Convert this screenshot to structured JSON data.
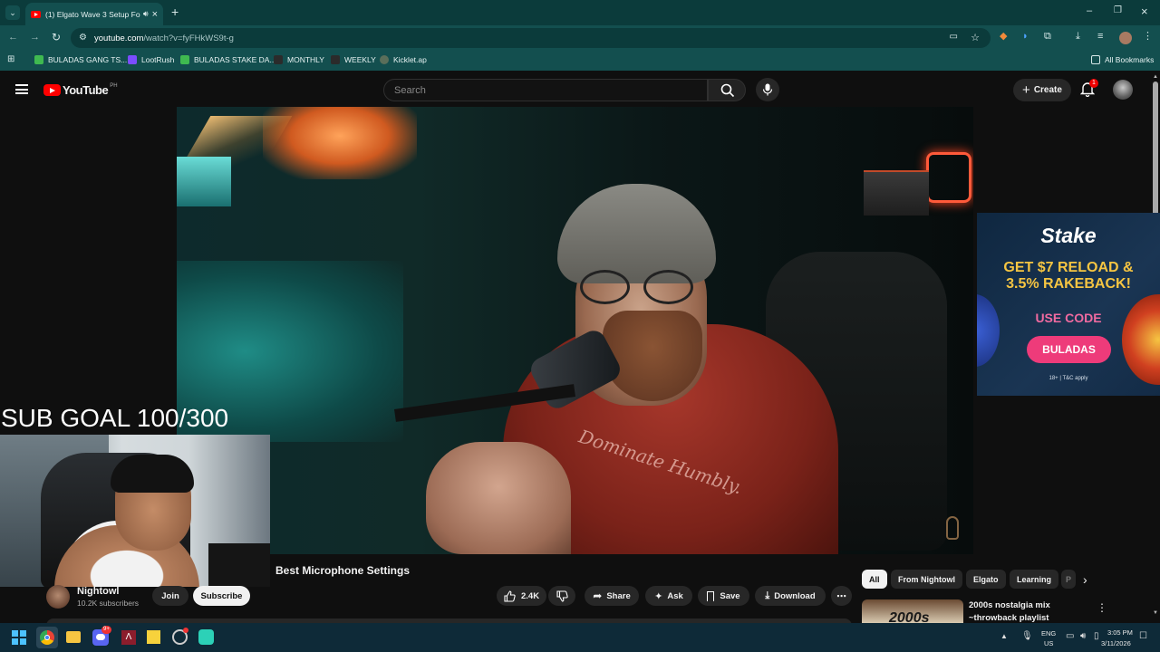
{
  "browser": {
    "tab_title": "(1) Elgato Wave 3 Setup Fo",
    "url_host": "youtube.com",
    "url_path": "/watch?v=fyFHkWS9t-g",
    "bookmarks": [
      {
        "label": "BULADAS GANG TS...",
        "color": "#3fb950"
      },
      {
        "label": "LootRush",
        "color": "#7b4dff"
      },
      {
        "label": "BULADAS STAKE DA...",
        "color": "#3fb950"
      },
      {
        "label": "MONTHLY",
        "color": "#2b2b2b"
      },
      {
        "label": "WEEKLY",
        "color": "#2b2b2b"
      },
      {
        "label": "Kicklet.ap",
        "color": "#5a6e5a"
      }
    ],
    "all_bookmarks": "All Bookmarks"
  },
  "youtube": {
    "logo": "YouTube",
    "region": "PH",
    "search_placeholder": "Search",
    "create_label": "Create",
    "notification_count": "1"
  },
  "overlay": {
    "sub_goal": "SUB GOAL 100/300"
  },
  "ad": {
    "brand": "Stake",
    "line1": "GET $7 RELOAD &",
    "line2": "3.5% RAKEBACK!",
    "use_code": "USE CODE",
    "code": "BULADAS",
    "disclaimer": "18+ | T&C apply"
  },
  "video": {
    "title_visible": "Best Microphone Settings",
    "channel_name": "Nightowl",
    "subscribers": "10.2K subscribers",
    "join_label": "Join",
    "subscribe_label": "Subscribe",
    "likes": "2.4K",
    "share_label": "Share",
    "ask_label": "Ask",
    "save_label": "Save",
    "download_label": "Download",
    "shirt_text": "Dominate Humbly."
  },
  "chips": [
    "All",
    "From Nightowl",
    "Elgato",
    "Learning",
    "P"
  ],
  "recommendation": {
    "title_line1": "2000s nostalgia mix",
    "title_line2": "~throwback playlist",
    "thumb_text": "2000s"
  },
  "taskbar": {
    "lang": "ENG",
    "region": "US",
    "time": "3:05 PM",
    "date": "3/11/2026",
    "discord_badge": "9+"
  }
}
